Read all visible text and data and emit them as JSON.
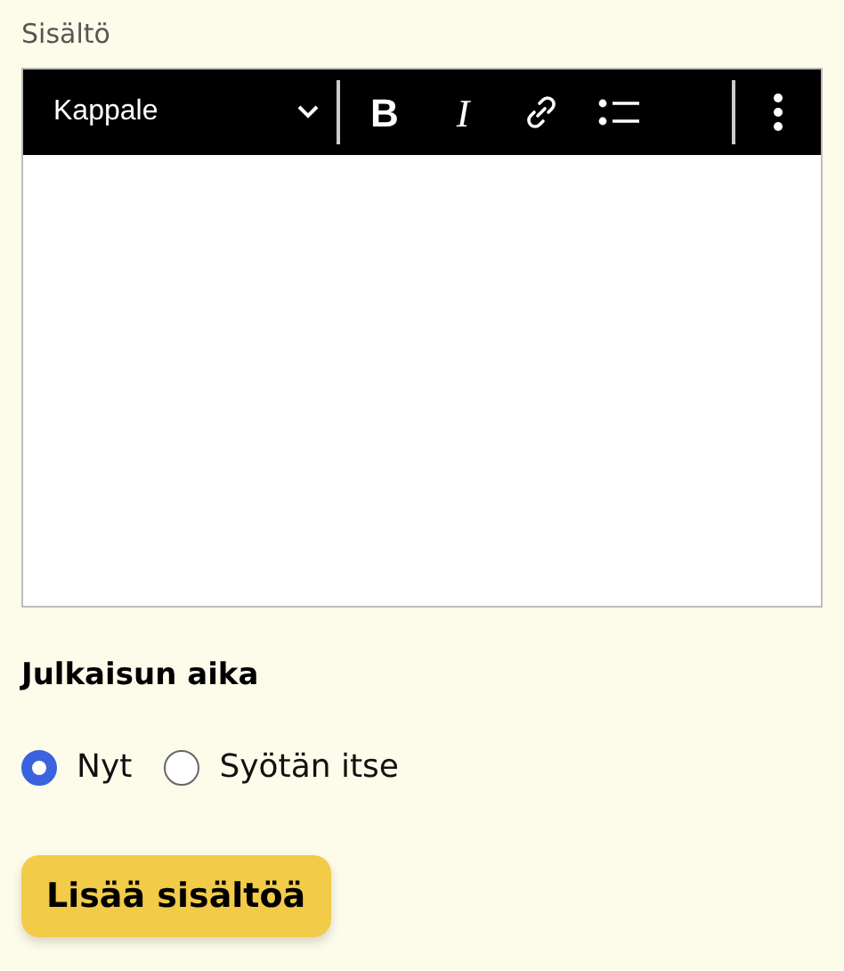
{
  "content_label": "Sisältö",
  "editor": {
    "block_type": "Kappale",
    "tools": [
      {
        "kind": "bold",
        "text": "B"
      },
      {
        "kind": "italic",
        "text": "I"
      },
      {
        "kind": "link"
      },
      {
        "kind": "list"
      }
    ]
  },
  "publish_time": {
    "heading": "Julkaisun aika",
    "options": [
      {
        "label": "Nyt",
        "selected": true
      },
      {
        "label": "Syötän itse",
        "selected": false
      }
    ]
  },
  "submit_button": "Lisää sisältöä"
}
